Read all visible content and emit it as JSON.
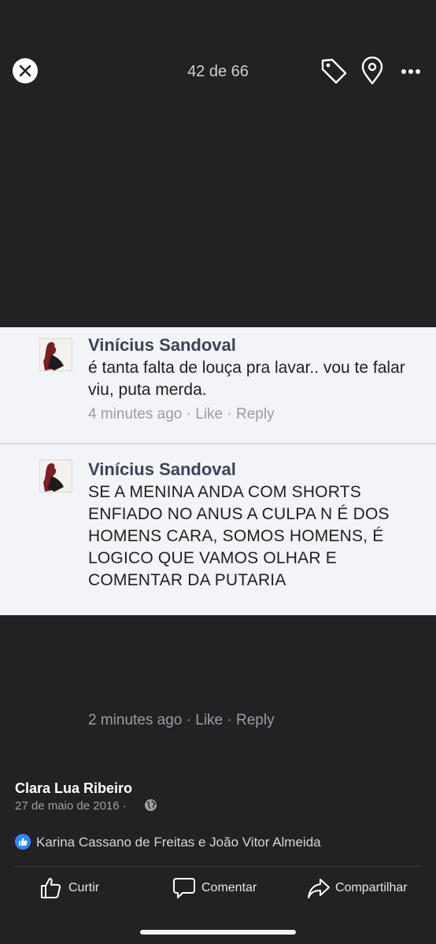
{
  "viewer": {
    "counter": "42 de 66"
  },
  "comments": [
    {
      "author": "Vinícius Sandoval",
      "text": "é tanta falta de louça pra lavar.. vou te falar viu, puta merda.",
      "time": "4 minutes ago",
      "like": "Like",
      "reply": "Reply"
    },
    {
      "author": "Vinícius Sandoval",
      "text": "SE A MENINA ANDA COM SHORTS ENFIADO NO ANUS A CULPA N É DOS HOMENS CARA, SOMOS HOMENS, É LOGICO QUE VAMOS OLHAR E COMENTAR DA PUTARIA",
      "time": "2 minutes ago",
      "like": "Like",
      "reply": "Reply"
    }
  ],
  "post": {
    "author": "Clara Lua Ribeiro",
    "date": "27 de maio de 2016 ·",
    "likers": "Karina Cassano de Freitas e João Vitor Almeida"
  },
  "actions": {
    "like": "Curtir",
    "comment": "Comentar",
    "share": "Compartilhar"
  },
  "colors": {
    "background": "#222224",
    "like_blue": "#2d88ff",
    "author_name": "#3b4358"
  },
  "icons": [
    "close-icon",
    "tag-icon",
    "location-pin-icon",
    "more-icon",
    "globe-icon",
    "like-badge-icon",
    "thumbs-up-icon",
    "comment-icon",
    "share-icon"
  ]
}
